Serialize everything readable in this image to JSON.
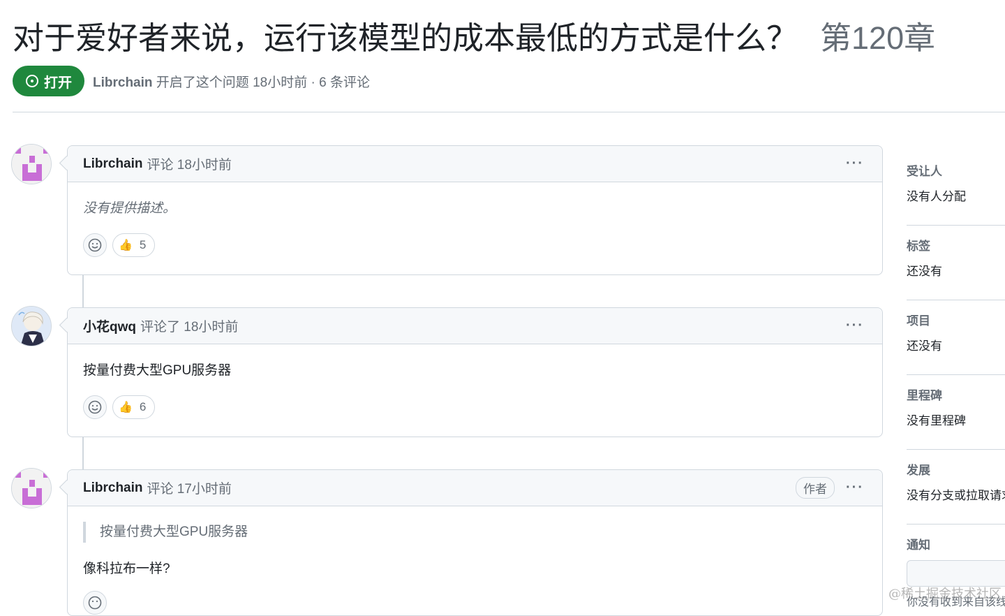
{
  "issue": {
    "title": "对于爱好者来说，运行该模型的成本最低的方式是什么？",
    "number": "第120章",
    "state_label": "打开",
    "author": "Librchain",
    "meta_text": "开启了这个问题 18小时前 · 6 条评论"
  },
  "comments": [
    {
      "author": "Librchain",
      "action": "评论 18小时前",
      "body": "没有提供描述。",
      "body_italic": true,
      "thumbs_count": "5"
    },
    {
      "author": "小花qwq",
      "action": "评论了 18小时前",
      "body": "按量付费大型GPU服务器",
      "thumbs_count": "6"
    },
    {
      "author": "Librchain",
      "action": "评论 17小时前",
      "badge": "作者",
      "quote": "按量付费大型GPU服务器",
      "body": "像科拉布一样?"
    }
  ],
  "sidebar": {
    "sections": [
      {
        "heading": "受让人",
        "value": "没有人分配"
      },
      {
        "heading": "标签",
        "value": "还没有"
      },
      {
        "heading": "项目",
        "value": "还没有"
      },
      {
        "heading": "里程碑",
        "value": "没有里程碑"
      },
      {
        "heading": "发展",
        "value": "没有分支或拉取请求"
      },
      {
        "heading": "通知",
        "value": ""
      }
    ],
    "notify_note": "你没有收到来自该线程的通知"
  },
  "watermark": "@稀土掘金技术社区",
  "colors": {
    "open_green": "#1f883d",
    "border": "#d0d7de",
    "muted_text": "#656d76",
    "header_bg": "#f6f8fa"
  },
  "icons": [
    "issue-opened-icon",
    "smiley-icon",
    "thumbs-up-icon",
    "kebab-horizontal-icon"
  ]
}
